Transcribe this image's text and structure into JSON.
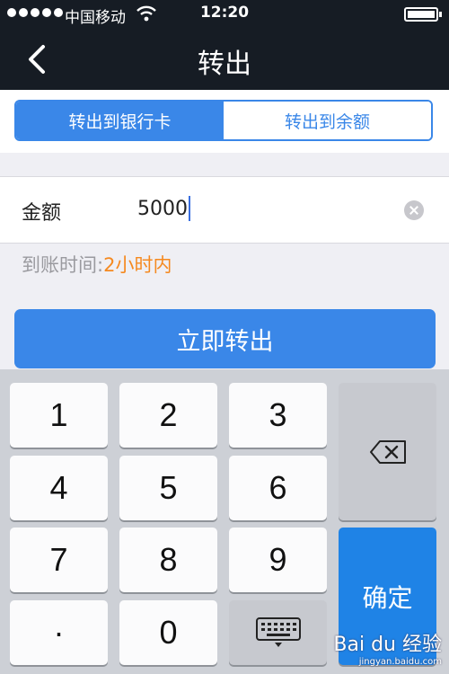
{
  "status_bar": {
    "carrier": "中国移动",
    "time": "12:20"
  },
  "nav": {
    "title": "转出"
  },
  "segments": [
    {
      "label": "转出到银行卡",
      "active": true
    },
    {
      "label": "转出到余额",
      "active": false
    }
  ],
  "amount": {
    "label": "金额",
    "value": "5000"
  },
  "arrival": {
    "prefix": "到账时间:",
    "value": "2小时内",
    "highlight_color": "#f5891f"
  },
  "submit_label": "立即转出",
  "keyboard": {
    "keys": [
      "1",
      "2",
      "3",
      "4",
      "5",
      "6",
      "7",
      "8",
      "9",
      "·",
      "0"
    ],
    "confirm_label": "确定",
    "delete_icon": "backspace-icon",
    "hide_icon": "keyboard-hide-icon"
  },
  "watermark": {
    "brand": "Bai du 经验",
    "url": "jingyan.baidu.com"
  },
  "colors": {
    "accent": "#3a87e8",
    "header_bg": "#161c24",
    "confirm_key": "#1f83e6"
  }
}
